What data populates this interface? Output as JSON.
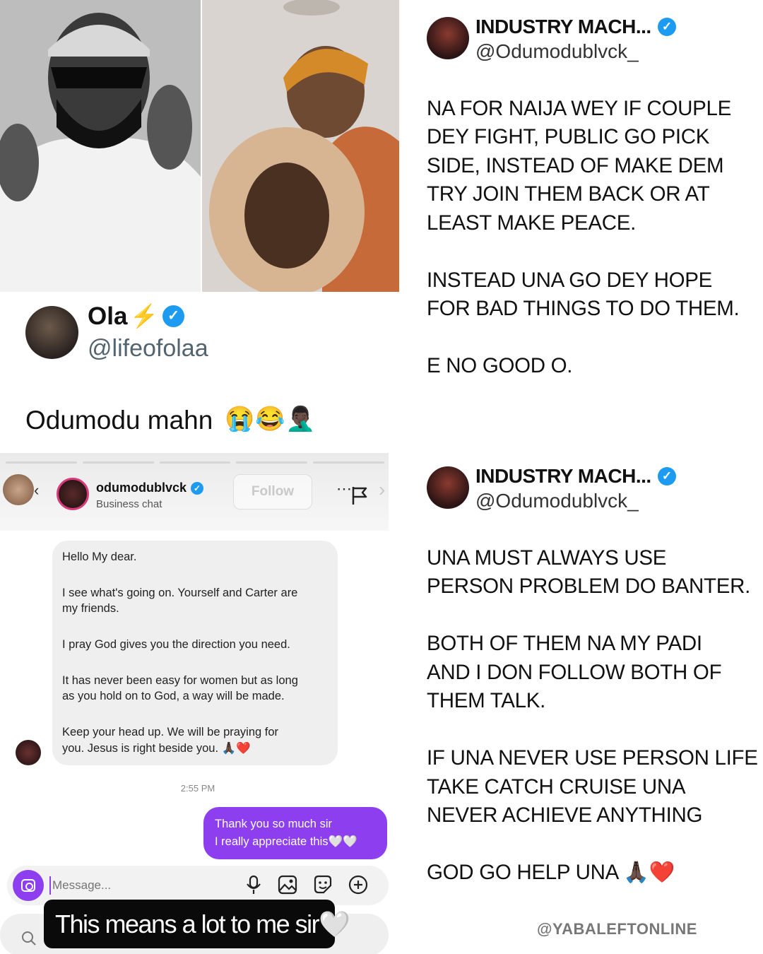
{
  "ola_tweet": {
    "display_name": "Ola",
    "handle": "@lifeofolaa",
    "text": "Odumodu mahn",
    "emojis": [
      "😭",
      "😂",
      "🤦🏿‍♂️"
    ]
  },
  "dm": {
    "username": "odumodublvck",
    "subtitle": "Business chat",
    "follow_label": "Follow",
    "incoming_messages": [
      "Hello My dear.",
      "I see what's going on. Yourself and Carter are",
      "my friends.",
      "I pray God gives you the direction you need.",
      "It has never been easy for women but as long",
      "as you hold on to God, a way will be made.",
      "Keep your head up. We will be praying for",
      "you. Jesus is right beside you. 🙏🏿❤️"
    ],
    "timestamp": "2:55 PM",
    "outgoing_lines": [
      "Thank you so much sir",
      "I really appreciate this🤍🤍"
    ],
    "composer_placeholder": "Message...",
    "caption": "This means a lot to me sir🤍"
  },
  "tweet1": {
    "display_name": "INDUSTRY MACH...",
    "handle": "@Odumodublvck_",
    "lines": [
      "NA FOR NAIJA WEY IF COUPLE",
      "DEY FIGHT, PUBLIC GO PICK",
      "SIDE, INSTEAD OF MAKE DEM",
      "TRY JOIN THEM BACK OR AT",
      "LEAST MAKE PEACE.",
      "INSTEAD UNA GO DEY HOPE",
      "FOR BAD THINGS TO DO THEM.",
      "E NO GOOD O."
    ]
  },
  "tweet2": {
    "display_name": "INDUSTRY MACH...",
    "handle": "@Odumodublvck_",
    "lines": [
      "UNA MUST ALWAYS USE",
      "PERSON PROBLEM DO BANTER.",
      "BOTH OF THEM NA MY PADI",
      "AND I DON FOLLOW BOTH OF",
      "THEM TALK.",
      "IF UNA NEVER USE PERSON LIFE",
      "TAKE CATCH CRUISE UNA",
      "NEVER ACHIEVE ANYTHING",
      "GOD GO HELP UNA 🙏🏿❤️"
    ]
  },
  "watermark": "@YABALEFTONLINE",
  "colors": {
    "verified": "#1d9bf0",
    "dm_purple": "#8d3ff0"
  }
}
